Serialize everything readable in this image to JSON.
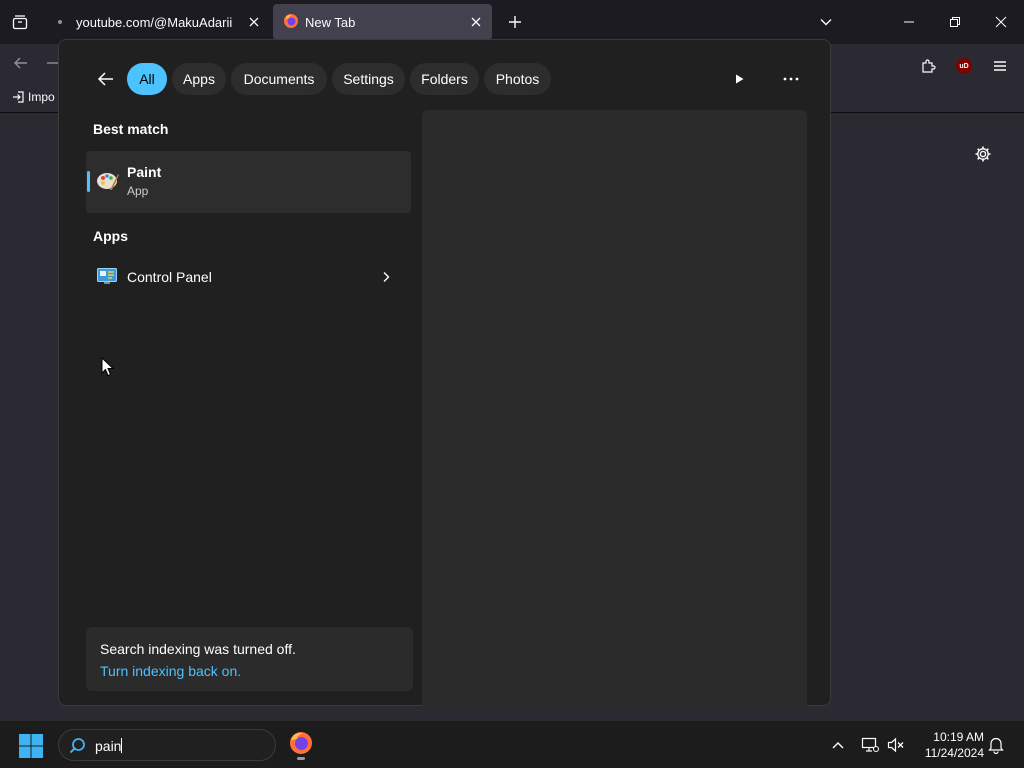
{
  "browser": {
    "tabs": [
      {
        "title": "youtube.com/@MakuAdarii",
        "active": false
      },
      {
        "title": "New Tab",
        "active": true
      }
    ],
    "bookmarks": {
      "import_label": "Impo"
    },
    "ublock_label": "uD"
  },
  "search": {
    "filters": [
      {
        "label": "All",
        "active": true
      },
      {
        "label": "Apps",
        "active": false
      },
      {
        "label": "Documents",
        "active": false
      },
      {
        "label": "Settings",
        "active": false
      },
      {
        "label": "Folders",
        "active": false
      },
      {
        "label": "Photos",
        "active": false
      }
    ],
    "best_match": {
      "heading": "Best match",
      "name": "Paint",
      "type": "App"
    },
    "apps": {
      "heading": "Apps",
      "items": [
        {
          "name": "Control Panel",
          "icon": "control-panel-icon"
        }
      ]
    },
    "notice": {
      "message": "Search indexing was turned off.",
      "link": "Turn indexing back on."
    }
  },
  "taskbar": {
    "search_query": "pain",
    "time": "10:19 AM",
    "date": "11/24/2024"
  },
  "colors": {
    "accent": "#4cc2ff",
    "flyout_bg": "#202020",
    "panel_bg": "#2b2b2b"
  }
}
